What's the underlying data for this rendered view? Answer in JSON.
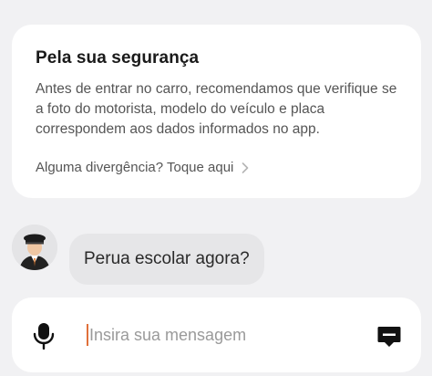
{
  "safety_card": {
    "title": "Pela sua segurança",
    "body": "Antes de entrar no carro, recomendamos que verifique se a foto do motorista, modelo do veículo e placa correspondem aos dados informados no app.",
    "link_label": "Alguma divergência? Toque aqui",
    "link_icon": "chevron-right-icon"
  },
  "chat": {
    "messages": [
      {
        "sender": "driver",
        "avatar_icon": "driver-avatar-icon",
        "text": "Perua escolar agora?"
      }
    ]
  },
  "composer": {
    "mic_icon": "microphone-icon",
    "placeholder": "Insira sua mensagem",
    "value": "",
    "send_icon": "message-send-icon"
  },
  "colors": {
    "background": "#f1f1f3",
    "card": "#ffffff",
    "bubble": "#e6e6e8",
    "caret": "#e0703a",
    "icon": "#111111"
  }
}
